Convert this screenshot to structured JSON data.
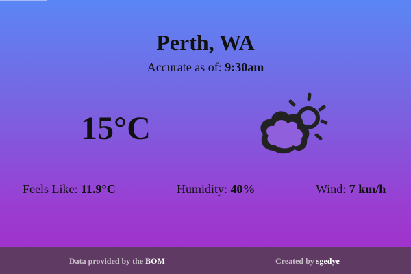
{
  "location": "Perth, WA",
  "accuracy": {
    "label": "Accurate as of: ",
    "time": "9:30am"
  },
  "temperature": "15°C",
  "weather_icon": "partly-cloudy-icon",
  "stats": {
    "feels_like": {
      "label": "Feels Like: ",
      "value": "11.9°C"
    },
    "humidity": {
      "label": "Humidity: ",
      "value": "40%"
    },
    "wind": {
      "label": "Wind: ",
      "value": "7 km/h"
    }
  },
  "footer": {
    "data_label": "Data provided by the ",
    "data_link": "BOM",
    "created_label": "Created by ",
    "created_link": "sgedye"
  },
  "colors": {
    "gradient_top": "#5b86f5",
    "gradient_bottom": "#a42bc8",
    "footer_bg": "#5f3a63"
  }
}
